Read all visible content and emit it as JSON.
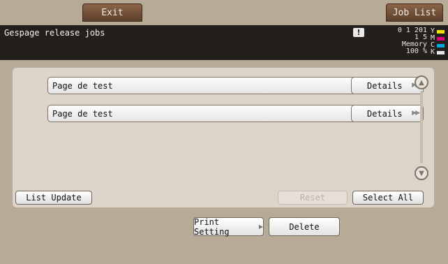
{
  "top_tabs": {
    "exit_label": "Exit",
    "job_list_label": "Job List"
  },
  "status": {
    "title": "Gespage release jobs",
    "warning_icon": "!",
    "counter_line1": "0 1 201",
    "counter_line2": "1 5",
    "memory_label": "Memory",
    "memory_value": "100 %"
  },
  "toner": [
    {
      "letter": "Y",
      "color": "#f2e200"
    },
    {
      "letter": "M",
      "color": "#e0007a"
    },
    {
      "letter": "C",
      "color": "#00a7e0"
    },
    {
      "letter": "K",
      "color": "#e6e6e6"
    }
  ],
  "jobs": [
    {
      "name": "Page de test",
      "details_label": "Details"
    },
    {
      "name": "Page de test",
      "details_label": "Details"
    }
  ],
  "icons": {
    "details_arrow": "▶▶",
    "scroll_up": "▲",
    "scroll_down": "▼",
    "print_setting_arrow": "▶"
  },
  "panel_buttons": {
    "list_update": "List Update",
    "reset": "Reset",
    "select_all": "Select All"
  },
  "bottom_buttons": {
    "print_setting": "Print Setting",
    "delete": "Delete"
  }
}
